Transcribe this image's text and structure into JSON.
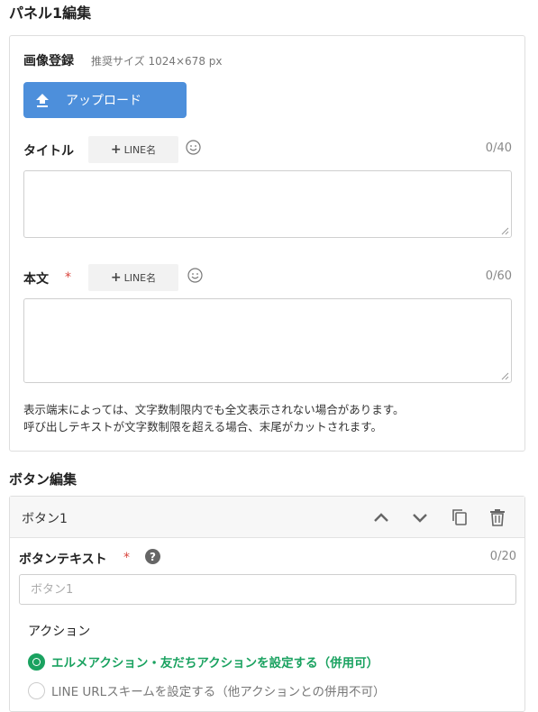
{
  "panel_heading": "パネル1編集",
  "image": {
    "label": "画像登録",
    "hint": "推奨サイズ 1024×678 px",
    "upload_label": "アップロード"
  },
  "title_field": {
    "label": "タイトル",
    "line_name_label": "LINE名",
    "counter": "0/40",
    "value": ""
  },
  "body_field": {
    "label": "本文",
    "required_mark": "*",
    "line_name_label": "LINE名",
    "counter": "0/60",
    "value": ""
  },
  "notes": {
    "line1": "表示端末によっては、文字数制限内でも全文表示されない場合があります。",
    "line2": "呼び出しテキストが文字数制限を超える場合、末尾がカットされます。"
  },
  "button_section": {
    "heading": "ボタン編集",
    "card_title": "ボタン1",
    "text_label": "ボタンテキスト",
    "required_mark": "*",
    "help_glyph": "?",
    "counter": "0/20",
    "placeholder": "ボタン1",
    "value": "",
    "action_label": "アクション",
    "options": [
      {
        "label": "エルメアクション・友だちアクションを設定する（併用可）",
        "selected": true
      },
      {
        "label": "LINE URLスキームを設定する（他アクションとの併用不可）",
        "selected": false
      }
    ]
  },
  "colors": {
    "accent_blue": "#4d8fdb",
    "accent_green": "#1aa260",
    "required_red": "#d9453d"
  },
  "icons": [
    "upload-icon",
    "smile-icon",
    "plus-icon",
    "chevron-up-icon",
    "chevron-down-icon",
    "copy-icon",
    "trash-icon",
    "help-icon",
    "resize-grip-icon"
  ]
}
